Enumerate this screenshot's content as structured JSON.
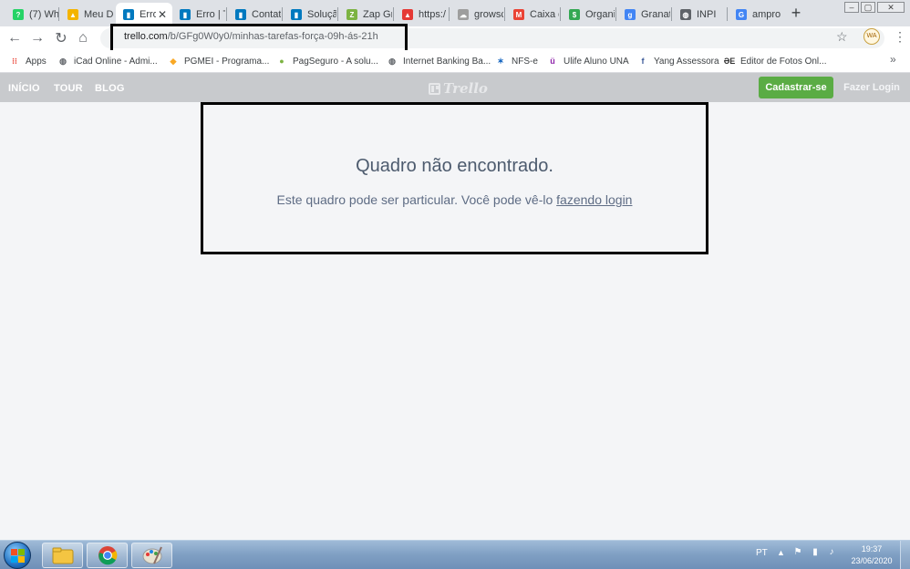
{
  "browser": {
    "tabs": [
      {
        "title": "(7) Wh",
        "icon": "whatsapp-icon",
        "color": "#25d366",
        "glyph": "?"
      },
      {
        "title": "Meu Dr",
        "icon": "drive-icon",
        "color": "#f4b400",
        "glyph": "▲"
      },
      {
        "title": "Erro",
        "icon": "trello-icon",
        "color": "#0079bf",
        "glyph": "▮",
        "active": true,
        "close": "✕"
      },
      {
        "title": "Erro | T",
        "icon": "trello-icon",
        "color": "#0079bf",
        "glyph": "▮"
      },
      {
        "title": "Contat",
        "icon": "trello-icon",
        "color": "#0079bf",
        "glyph": "▮"
      },
      {
        "title": "Soluçã",
        "icon": "trello-icon",
        "color": "#0079bf",
        "glyph": "▮"
      },
      {
        "title": "Zap Gr",
        "icon": "zap-icon",
        "color": "#7cb342",
        "glyph": "Z"
      },
      {
        "title": "https:/",
        "icon": "warning-icon",
        "color": "#e53935",
        "glyph": "▲"
      },
      {
        "title": "growsc",
        "icon": "cloud-icon",
        "color": "#9e9e9e",
        "glyph": "☁"
      },
      {
        "title": "Caixa d",
        "icon": "gmail-icon",
        "color": "#ea4335",
        "glyph": "M"
      },
      {
        "title": "Organi",
        "icon": "dollar-icon",
        "color": "#34a853",
        "glyph": "$"
      },
      {
        "title": "Granat",
        "icon": "g-icon",
        "color": "#4285f4",
        "glyph": "g"
      },
      {
        "title": "INPI",
        "icon": "globe-icon",
        "color": "#5f6368",
        "glyph": "◍"
      },
      {
        "title": "ampro",
        "icon": "google-icon",
        "color": "#4285f4",
        "glyph": "G"
      }
    ],
    "new_tab": "+",
    "url_host": "trello.com",
    "url_path": "/b/GFg0W0y0/minhas-tarefas-força-09h-ás-21h",
    "ext_label": "WA",
    "bookmarks": [
      {
        "label": "Apps",
        "icon": "apps-grid-icon",
        "color": "#ea4335",
        "glyph": "⁝⁝"
      },
      {
        "label": "iCad Online - Admi...",
        "icon": "globe-icon",
        "color": "#5f6368",
        "glyph": "◍"
      },
      {
        "label": "PGMEI - Programa...",
        "icon": "pgmei-icon",
        "color": "#f9a825",
        "glyph": "◆"
      },
      {
        "label": "PagSeguro - A solu...",
        "icon": "pagseguro-icon",
        "color": "#7cb342",
        "glyph": "●"
      },
      {
        "label": "Internet Banking Ba...",
        "icon": "globe-icon",
        "color": "#5f6368",
        "glyph": "◍"
      },
      {
        "label": "NFS-e",
        "icon": "nfse-icon",
        "color": "#1565c0",
        "glyph": "✶"
      },
      {
        "label": "Ulife Aluno UNA",
        "icon": "ulife-icon",
        "color": "#8e24aa",
        "glyph": "ü"
      },
      {
        "label": "Yang Assessora",
        "icon": "facebook-icon",
        "color": "#3b5998",
        "glyph": "f"
      },
      {
        "label": "Editor de Fotos Onl...",
        "icon": "photo-editor-icon",
        "color": "#333333",
        "glyph": "ƏE"
      }
    ]
  },
  "trello": {
    "nav": [
      "INÍCIO",
      "TOUR",
      "BLOG"
    ],
    "logo_text": "Trello",
    "signup": "Cadastrar-se",
    "login": "Fazer Login",
    "error_title": "Quadro não encontrado.",
    "error_msg": "Este quadro pode ser particular. Você pode vê-lo ",
    "error_link": "fazendo login"
  },
  "taskbar": {
    "lang": "PT",
    "time": "19:37",
    "date": "23/06/2020"
  },
  "colors": {
    "signup_green": "#5aac44",
    "header_gray": "#c8cacd",
    "title_text": "#4d5b6e"
  }
}
